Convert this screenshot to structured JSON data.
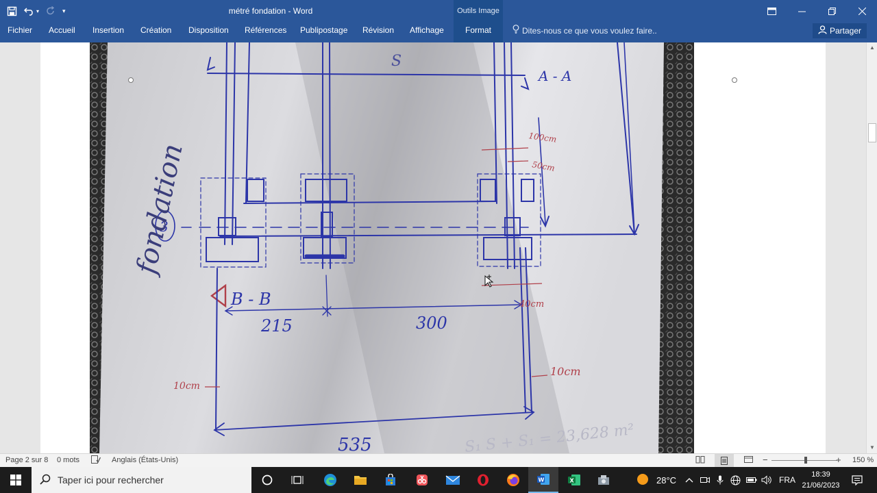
{
  "window": {
    "title": "métré fondation - Word",
    "context_group": "Outils Image"
  },
  "qat": {
    "save_icon": "save-icon",
    "undo_icon": "undo-icon",
    "redo_icon": "redo-icon",
    "customize_icon": "customize-qat-icon"
  },
  "ribbon": {
    "tabs": [
      "Fichier",
      "Accueil",
      "Insertion",
      "Création",
      "Disposition",
      "Références",
      "Publipostage",
      "Révision",
      "Affichage"
    ],
    "context_tab": "Format",
    "tell_me": "Dites-nous ce que vous voulez faire..",
    "share": "Partager"
  },
  "drawing": {
    "section_a": "A - A",
    "section_b": "B - B",
    "axis_number": "3",
    "vertical_label": "fondation",
    "label_s": "S",
    "dim_100cm": "100cm",
    "dim_50cm": "50cm",
    "dim_215": "215",
    "dim_300": "300",
    "dim_40cm": "40cm",
    "dim_10cm_right": "10cm",
    "dim_10cm_left": "10cm",
    "dim_535": "535",
    "formula": "S₁ S + S₁ = 23,628 m²"
  },
  "statusbar": {
    "page": "Page 2 sur 8",
    "words": "0 mots",
    "language": "Anglais (États-Unis)",
    "zoom": "150 %",
    "zoom_minus": "−",
    "zoom_plus": "+"
  },
  "taskbar": {
    "search_placeholder": "Taper ici pour rechercher",
    "weather": "28°C",
    "lang": "FRA",
    "time": "18:39",
    "date": "21/06/2023"
  },
  "colors": {
    "word_blue": "#2b579a",
    "context_blue": "#1e4e8c",
    "ink_blue": "#2c35a8",
    "ink_red": "#b0404a"
  }
}
